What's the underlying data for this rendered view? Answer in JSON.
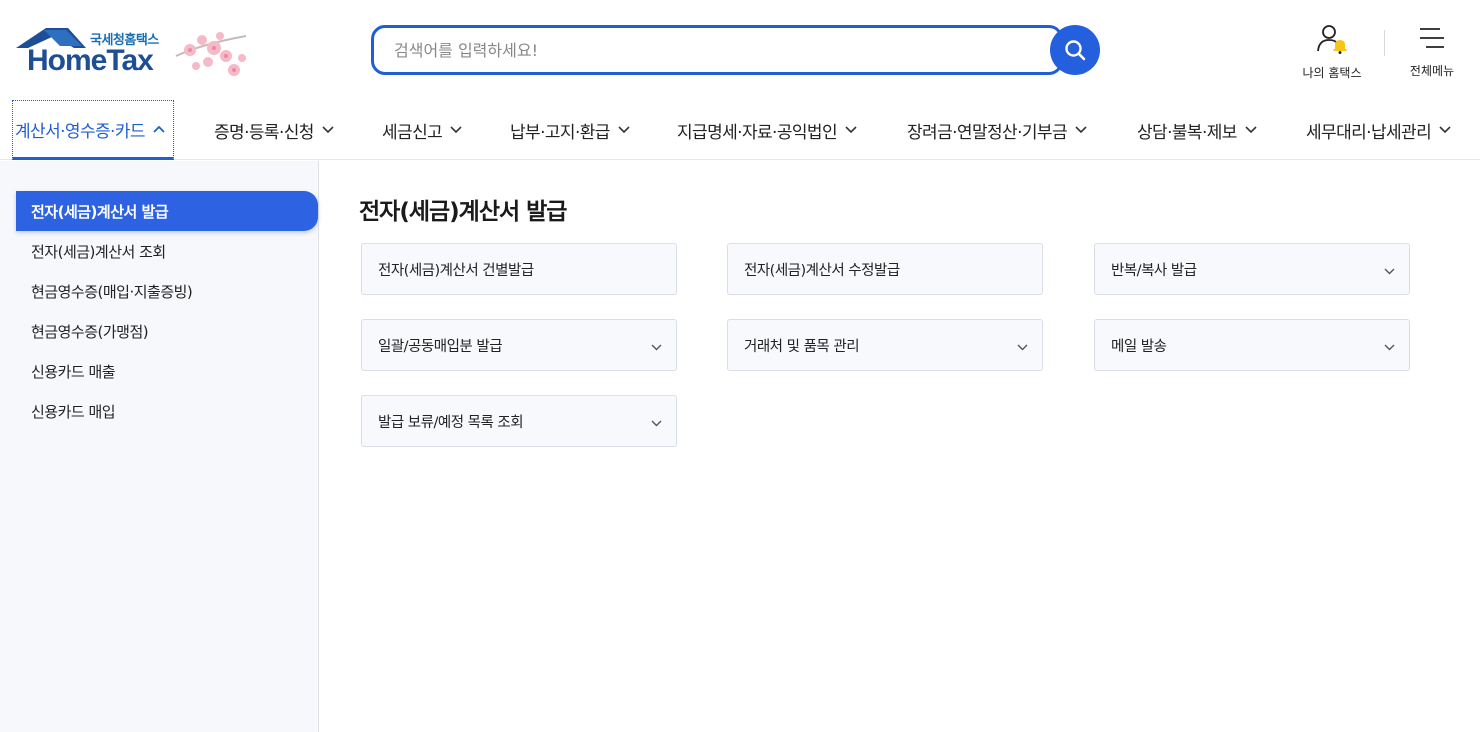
{
  "logo": {
    "small_text": "국세청홈택스",
    "big_text": "HomeTax"
  },
  "search": {
    "placeholder": "검색어를 입력하세요!"
  },
  "utilities": {
    "my_hometax": "나의 홈택스",
    "all_menu": "전체메뉴"
  },
  "nav": {
    "items": [
      {
        "label": "계산서·영수증·카드"
      },
      {
        "label": "증명·등록·신청"
      },
      {
        "label": "세금신고"
      },
      {
        "label": "납부·고지·환급"
      },
      {
        "label": "지급명세·자료·공익법인"
      },
      {
        "label": "장려금·연말정산·기부금"
      },
      {
        "label": "상담·불복·제보"
      },
      {
        "label": "세무대리·납세관리"
      }
    ]
  },
  "sidebar": {
    "items": [
      {
        "label": "전자(세금)계산서 발급"
      },
      {
        "label": "전자(세금)계산서 조회"
      },
      {
        "label": "현금영수증(매입·지출증빙)"
      },
      {
        "label": "현금영수증(가맹점)"
      },
      {
        "label": "신용카드 매출"
      },
      {
        "label": "신용카드 매입"
      }
    ]
  },
  "main": {
    "title": "전자(세금)계산서 발급",
    "cards": [
      {
        "label": "전자(세금)계산서 건별발급"
      },
      {
        "label": "전자(세금)계산서 수정발급"
      },
      {
        "label": "반복/복사 발급"
      },
      {
        "label": "일괄/공동매입분 발급"
      },
      {
        "label": "거래처 및 품목 관리"
      },
      {
        "label": "메일 발송"
      },
      {
        "label": "발급 보류/예정 목록 조회"
      }
    ]
  },
  "colors": {
    "primary": "#2d63e3",
    "logo_blue": "#1d4e96",
    "sidebar_bg": "#f7f8fb"
  }
}
